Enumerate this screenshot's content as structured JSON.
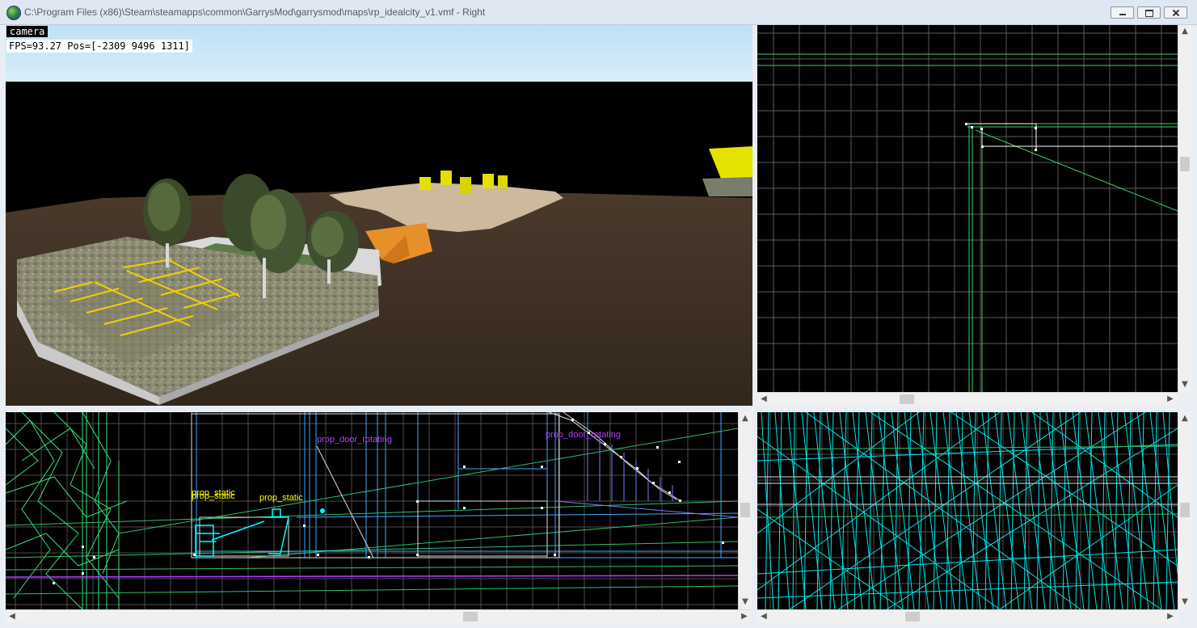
{
  "window": {
    "title": "C:\\Program Files (x86)\\Steam\\steamapps\\common\\GarrysMod\\garrysmod\\maps\\rp_idealcity_v1.vmf - Right",
    "minimize_icon": "minimize-icon",
    "maximize_icon": "restore-icon",
    "close_icon": "close-icon"
  },
  "camera_view": {
    "label": "camera",
    "stats": "FPS=93.27 Pos=[-2309 9496 1311]"
  },
  "front_view": {
    "entity_labels": [
      {
        "text": "prop_door_rotating",
        "color": "#b040ff"
      },
      {
        "text": "prop_door_rotating",
        "color": "#b040ff"
      },
      {
        "text": "prop_static",
        "color": "#ffff00"
      },
      {
        "text": "prop_static",
        "color": "#ffff00"
      },
      {
        "text": "prop_static",
        "color": "#ffff00"
      }
    ]
  },
  "scrollbars": {
    "up_arrow": "▲",
    "down_arrow": "▼",
    "left_arrow": "◀",
    "right_arrow": "▶"
  },
  "colors": {
    "sky": "#c8e4f6",
    "grid": "#5a5a5a",
    "brush_green": "#39e07a",
    "brush_cyan": "#00ffff",
    "entity_yellow": "#ffff00",
    "entity_purple": "#b040ff"
  }
}
